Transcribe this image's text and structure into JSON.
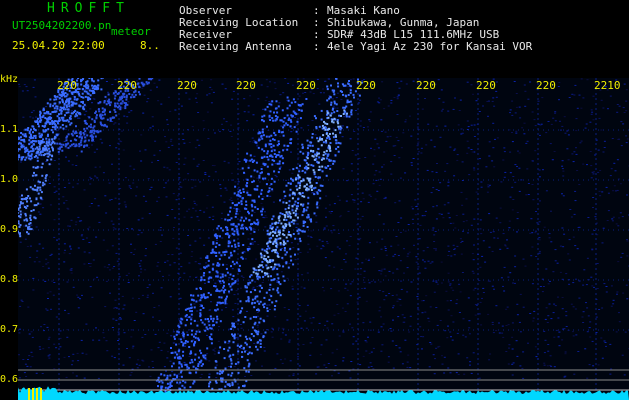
{
  "header": {
    "app_title": "HROFFT",
    "file_name": "UT2504202200.pn",
    "file_tag": "meteor",
    "date_time": "25.04.20 22:00",
    "date_extra": "8..",
    "info": [
      {
        "label": "Observer",
        "sep": ":",
        "value": "Masaki Kano"
      },
      {
        "label": "Receiving Location",
        "sep": ":",
        "value": "Shibukawa, Gunma, Japan"
      },
      {
        "label": "Receiver",
        "sep": ":",
        "value": "SDR# 43dB L15 111.6MHz USB"
      },
      {
        "label": "Receiving Antenna",
        "sep": ":",
        "value": "4ele Yagi Az 230 for Kansai VOR"
      }
    ]
  },
  "colors": {
    "label_green": "#00d000",
    "label_yellow": "#f0f000",
    "text_white": "#e8e8e8",
    "signal_cyan": "#00e0ff",
    "grid_blue": "#1030a0"
  },
  "axis": {
    "unit": "kHz",
    "y_ticks": [
      "1.1",
      "1.0",
      "0.9",
      "0.8",
      "0.7",
      "0.6"
    ],
    "x_ticks": [
      "220",
      "220",
      "220",
      "220",
      "220",
      "220",
      "220",
      "220",
      "220",
      "2210"
    ]
  }
}
